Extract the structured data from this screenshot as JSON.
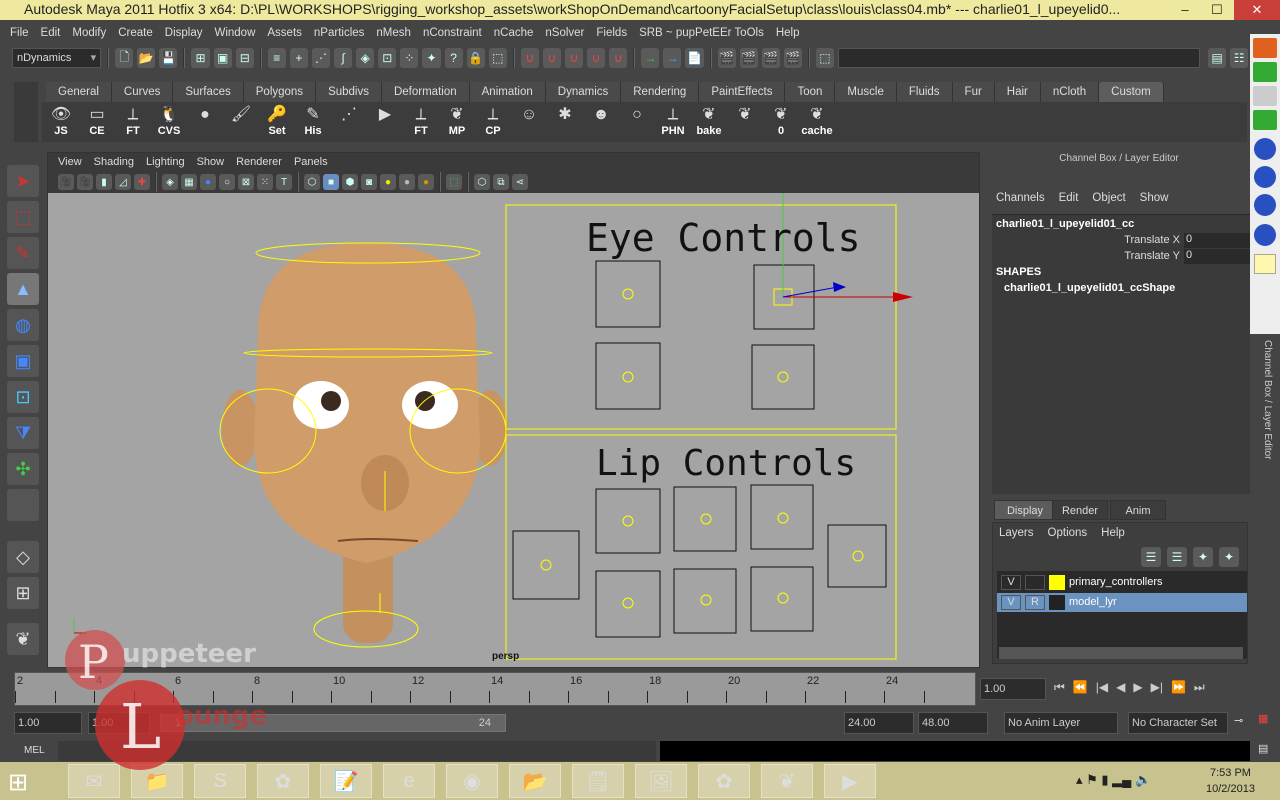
{
  "title": {
    "text": "Autodesk Maya 2011 Hotfix 3 x64: D:\\PL\\WORKSHOPS\\rigging_workshop_assets\\workShopOnDemand\\cartoonyFacialSetup\\class\\louis\\class04.mb*   ---   charlie01_l_upeyelid0...",
    "minimize": "–",
    "maximize": "☐",
    "close": "✕"
  },
  "menu": [
    "File",
    "Edit",
    "Modify",
    "Create",
    "Display",
    "Window",
    "Assets",
    "nParticles",
    "nMesh",
    "nConstraint",
    "nCache",
    "nSolver",
    "Fields",
    "SRB ~ pupPetEEr ToOls",
    "Help"
  ],
  "status": {
    "menuset": "nDynamics"
  },
  "shelf_tabs": [
    "General",
    "Curves",
    "Surfaces",
    "Polygons",
    "Subdivs",
    "Deformation",
    "Animation",
    "Dynamics",
    "Rendering",
    "PaintEffects",
    "Toon",
    "Muscle",
    "Fluids",
    "Fur",
    "Hair",
    "nCloth",
    "Custom"
  ],
  "shelf_active": "Custom",
  "shelf_items": [
    {
      "g": "👁",
      "l": "JS"
    },
    {
      "g": "▭",
      "l": "CE"
    },
    {
      "g": "⟂",
      "l": "FT"
    },
    {
      "g": "🐧",
      "l": "CVS"
    },
    {
      "g": "●",
      "l": ""
    },
    {
      "g": "🖌",
      "l": ""
    },
    {
      "g": "🔑",
      "l": "Set"
    },
    {
      "g": "✎",
      "l": "His"
    },
    {
      "g": "⋰",
      "l": ""
    },
    {
      "g": "▶",
      "l": ""
    },
    {
      "g": "⟂",
      "l": "FT"
    },
    {
      "g": "❦",
      "l": "MP"
    },
    {
      "g": "⟂",
      "l": "CP"
    },
    {
      "g": "☺",
      "l": ""
    },
    {
      "g": "✱",
      "l": ""
    },
    {
      "g": "☻",
      "l": ""
    },
    {
      "g": "○",
      "l": ""
    },
    {
      "g": "⟂",
      "l": "PHN"
    },
    {
      "g": "❦",
      "l": "bake"
    },
    {
      "g": "❦",
      "l": ""
    },
    {
      "g": "❦",
      "l": "0"
    },
    {
      "g": "❦",
      "l": "cache"
    }
  ],
  "viewport": {
    "menu": [
      "View",
      "Shading",
      "Lighting",
      "Show",
      "Renderer",
      "Panels"
    ],
    "camera": "persp",
    "eye_title": "Eye Controls",
    "lip_title": "Lip Controls"
  },
  "channel_box": {
    "header": "Channel Box / Layer Editor",
    "menu": [
      "Channels",
      "Edit",
      "Object",
      "Show"
    ],
    "object": "charlie01_l_upeyelid01_cc",
    "channels": [
      {
        "name": "Translate X",
        "value": "0"
      },
      {
        "name": "Translate Y",
        "value": "0"
      }
    ],
    "shapes_label": "SHAPES",
    "shape": "charlie01_l_upeyelid01_ccShape"
  },
  "layer_editor": {
    "tabs": [
      "Display",
      "Render",
      "Anim"
    ],
    "menu": [
      "Layers",
      "Options",
      "Help"
    ],
    "layers": [
      {
        "v": "V",
        "r": "",
        "color": "#ffff00",
        "name": "primary_controllers",
        "selected": false
      },
      {
        "v": "V",
        "r": "R",
        "color": "#222222",
        "name": "model_lyr",
        "selected": true
      }
    ]
  },
  "timeline": {
    "ticks": [
      "2",
      "4",
      "6",
      "8",
      "10",
      "12",
      "14",
      "16",
      "18",
      "20",
      "22",
      "24"
    ],
    "current_frame": "1.00"
  },
  "range": {
    "start": "1.00",
    "playback_start": "1.00",
    "slider_start": "1",
    "slider_end": "24",
    "playback_end": "24.00",
    "end": "48.00",
    "anim_layer": "No Anim Layer",
    "character_set": "No Character Set"
  },
  "mel": {
    "label": "MEL"
  },
  "taskbar": {
    "time": "7:53 PM",
    "date": "10/2/2013",
    "apps": [
      "outlook",
      "explorer",
      "skype",
      "flower",
      "notepad++",
      "ie",
      "chrome",
      "files",
      "notepad",
      "photo",
      "flower2",
      "maya",
      "recorder"
    ]
  },
  "watermark": "Puppeteer Lounge",
  "colors": {
    "title": "#efe9a0",
    "viewport": "#a4a4a4",
    "controls": "#ffff00",
    "selected_layer": "#6a93bf"
  }
}
